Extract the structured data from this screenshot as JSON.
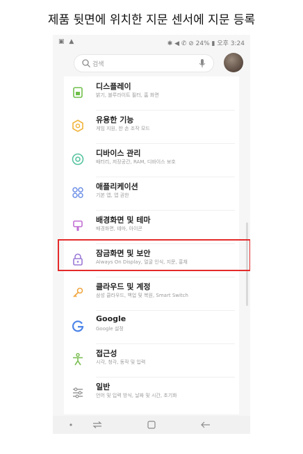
{
  "caption": "제품 뒷면에 위치한 지문 센서에 지문 등록",
  "status_bar": {
    "left": "▣ ▲",
    "right": "✱ ◀ ✆ ⊘ 24% ▮ 오후 3:24"
  },
  "search": {
    "placeholder": "검색"
  },
  "menu_items": [
    {
      "title": "디스플레이",
      "subtitle": "밝기, 블루라이트 필터, 홈 화면",
      "icon": "display-icon",
      "color": "#6fbf4a"
    },
    {
      "title": "유용한 기능",
      "subtitle": "게임 지원, 한 손 조작 모드",
      "icon": "gear-icon",
      "color": "#f0b33a"
    },
    {
      "title": "디바이스 관리",
      "subtitle": "배터리, 저장공간, RAM, 디바이스 보호",
      "icon": "device-care-icon",
      "color": "#56c3a0"
    },
    {
      "title": "애플리케이션",
      "subtitle": "기본 앱, 앱 권한",
      "icon": "apps-icon",
      "color": "#6c8fe6"
    },
    {
      "title": "배경화면 및 테마",
      "subtitle": "배경화면, 테마, 아이콘",
      "icon": "brush-icon",
      "color": "#c16fd3"
    },
    {
      "title": "잠금화면 및 보안",
      "subtitle": "Always On Display, 얼굴 인식, 지문, 홍채",
      "icon": "lock-icon",
      "color": "#9b78d6"
    },
    {
      "title": "클라우드 및 계정",
      "subtitle": "삼성 클라우드, 백업 및 복원, Smart Switch",
      "icon": "key-icon",
      "color": "#f0a640"
    },
    {
      "title": "Google",
      "subtitle": "Google 설정",
      "icon": "google-icon",
      "color": "#4c83e8"
    },
    {
      "title": "접근성",
      "subtitle": "시각, 청각, 동작 및 입력",
      "icon": "accessibility-icon",
      "color": "#7dbf55"
    },
    {
      "title": "일반",
      "subtitle": "언어 및 입력 방식, 날짜 및 시간, 초기화",
      "icon": "sliders-icon",
      "color": "#9a9a9a"
    }
  ],
  "colors": {
    "highlight": "#e52a2a"
  }
}
